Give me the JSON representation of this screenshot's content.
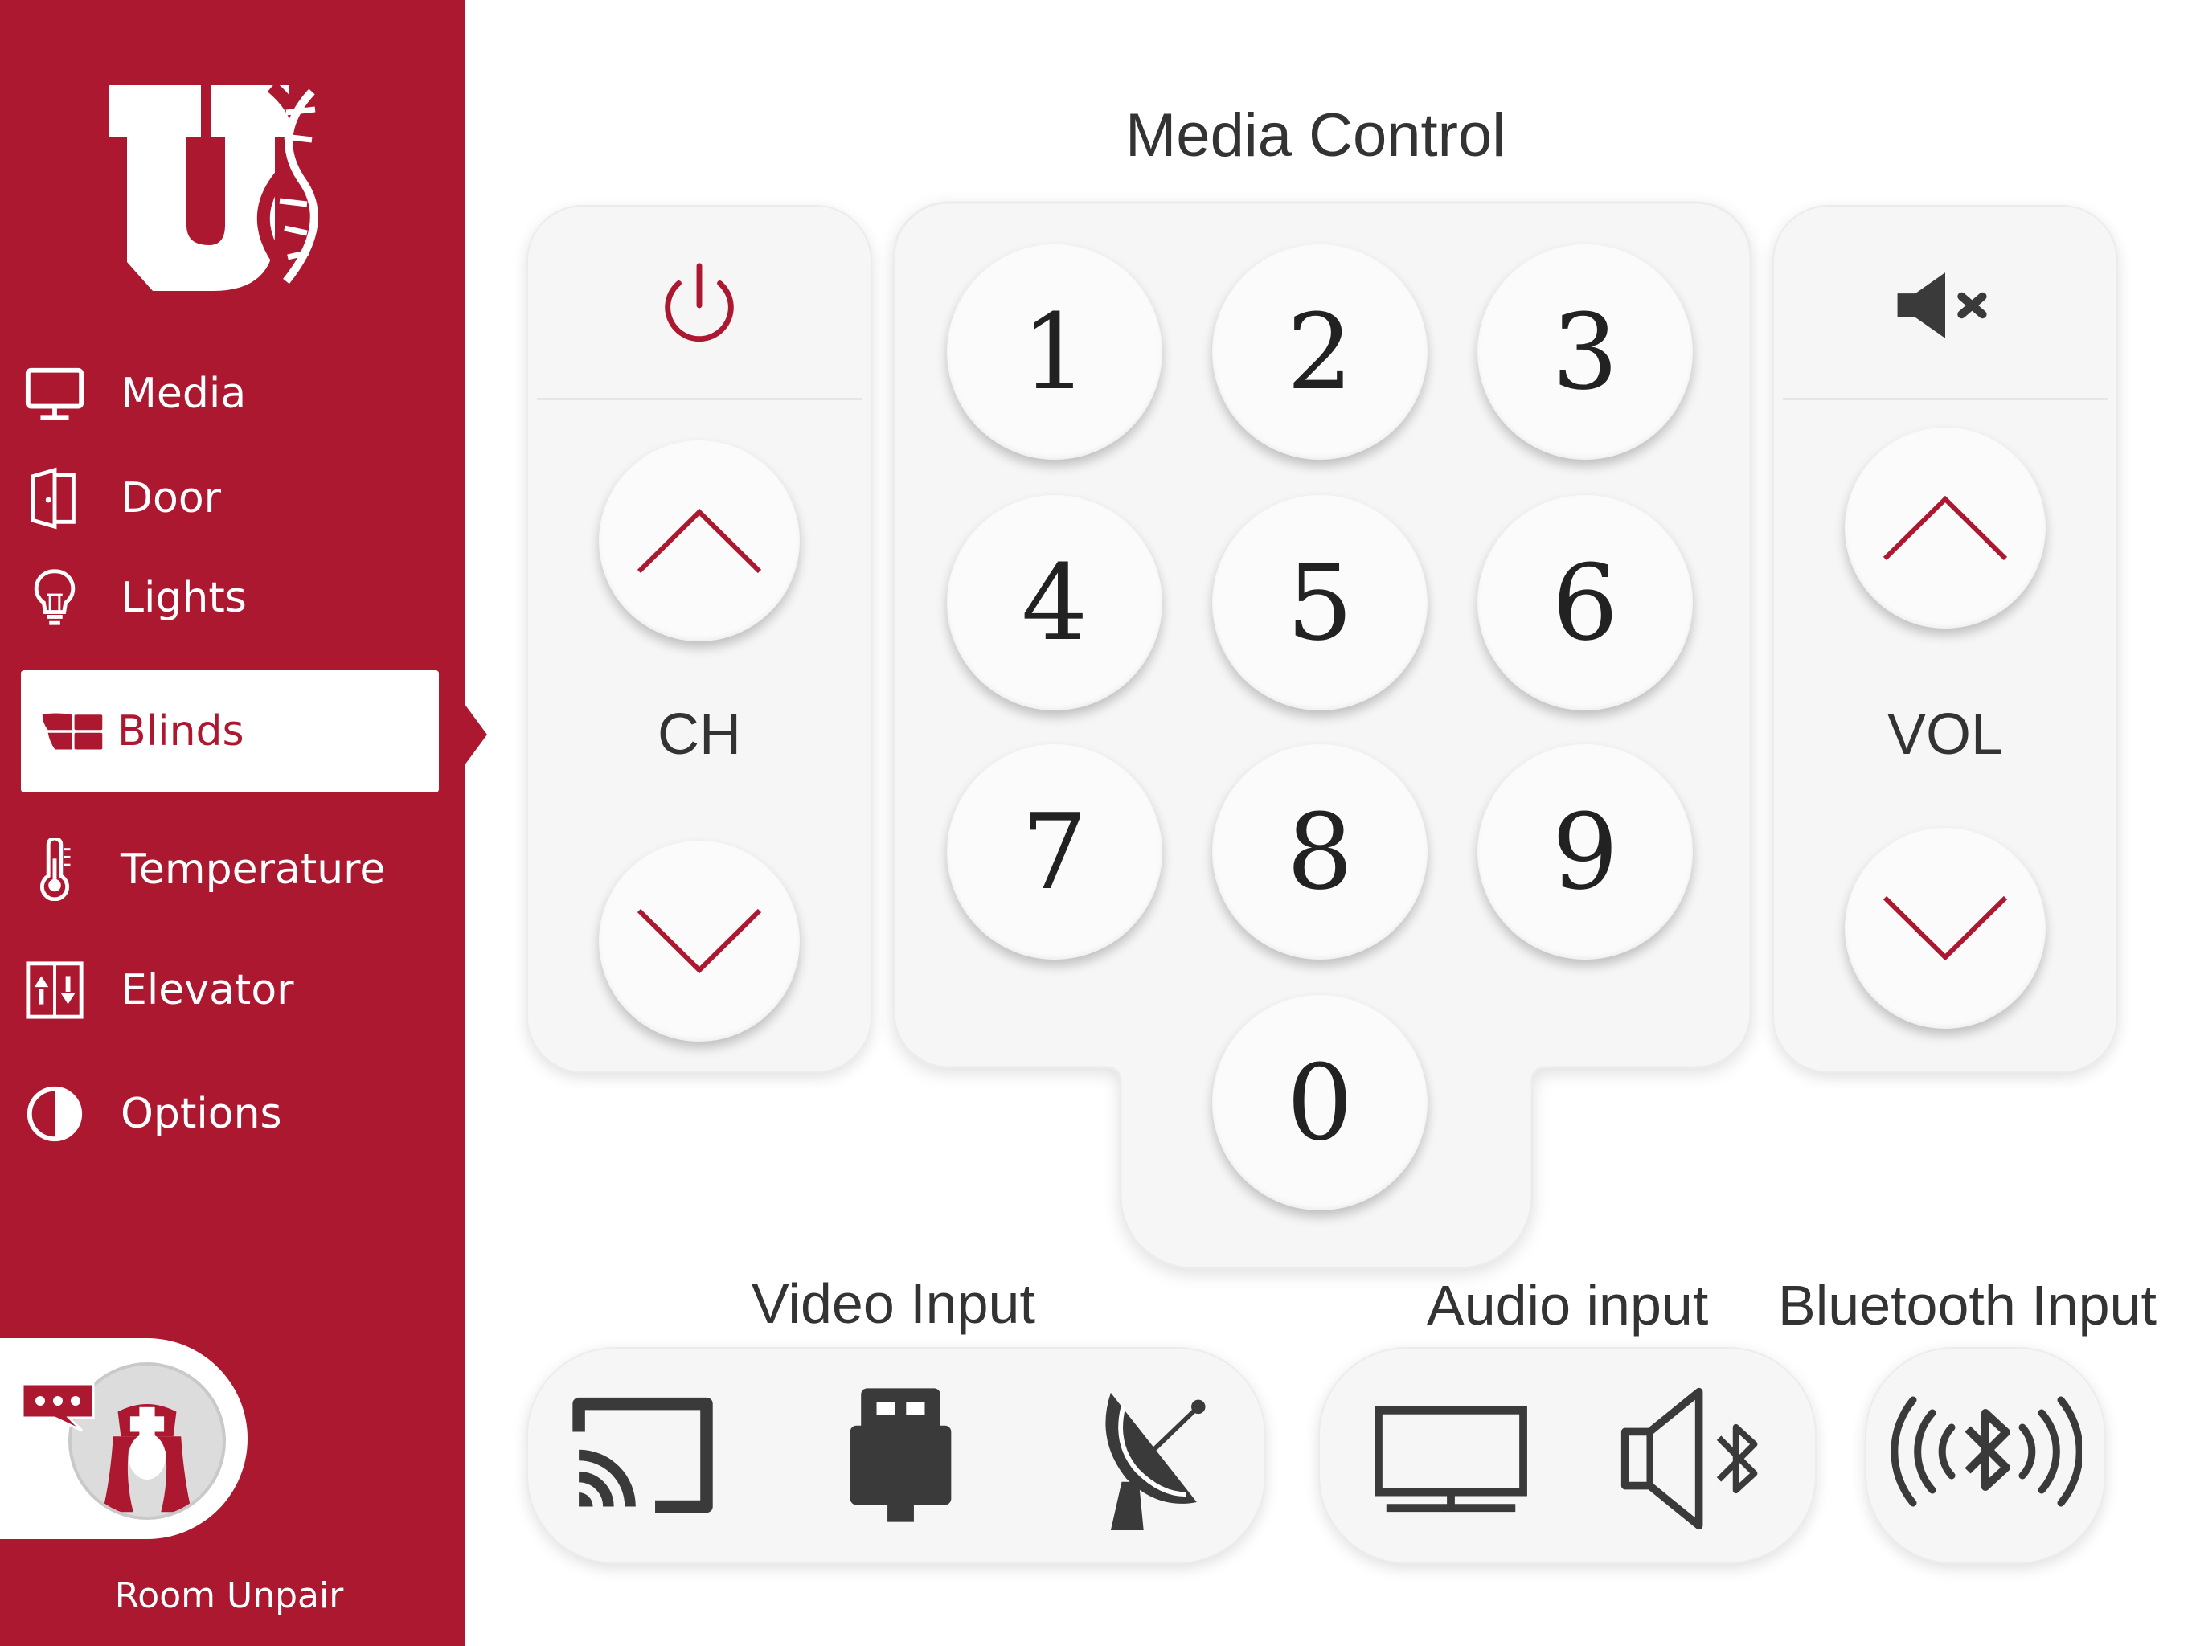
{
  "sidebar": {
    "items": [
      {
        "label": "Media",
        "icon": "monitor-icon"
      },
      {
        "label": "Door",
        "icon": "door-icon"
      },
      {
        "label": "Lights",
        "icon": "lightbulb-icon"
      },
      {
        "label": "Blinds",
        "icon": "blinds-icon",
        "active": true
      },
      {
        "label": "Temperature",
        "icon": "thermometer-icon"
      },
      {
        "label": "Elevator",
        "icon": "elevator-icon"
      },
      {
        "label": "Options",
        "icon": "contrast-icon"
      }
    ],
    "unpair_label": "Room Unpair"
  },
  "media": {
    "title": "Media Control",
    "channel_label": "CH",
    "volume_label": "VOL",
    "keypad": [
      "1",
      "2",
      "3",
      "4",
      "5",
      "6",
      "7",
      "8",
      "9",
      "0"
    ]
  },
  "inputs": {
    "video_title": "Video Input",
    "audio_title": "Audio input",
    "bluetooth_title": "Bluetooth Input"
  },
  "colors": {
    "accent": "#ad1831",
    "panel": "#f6f6f6",
    "icon_dark": "#3a3a3a"
  }
}
